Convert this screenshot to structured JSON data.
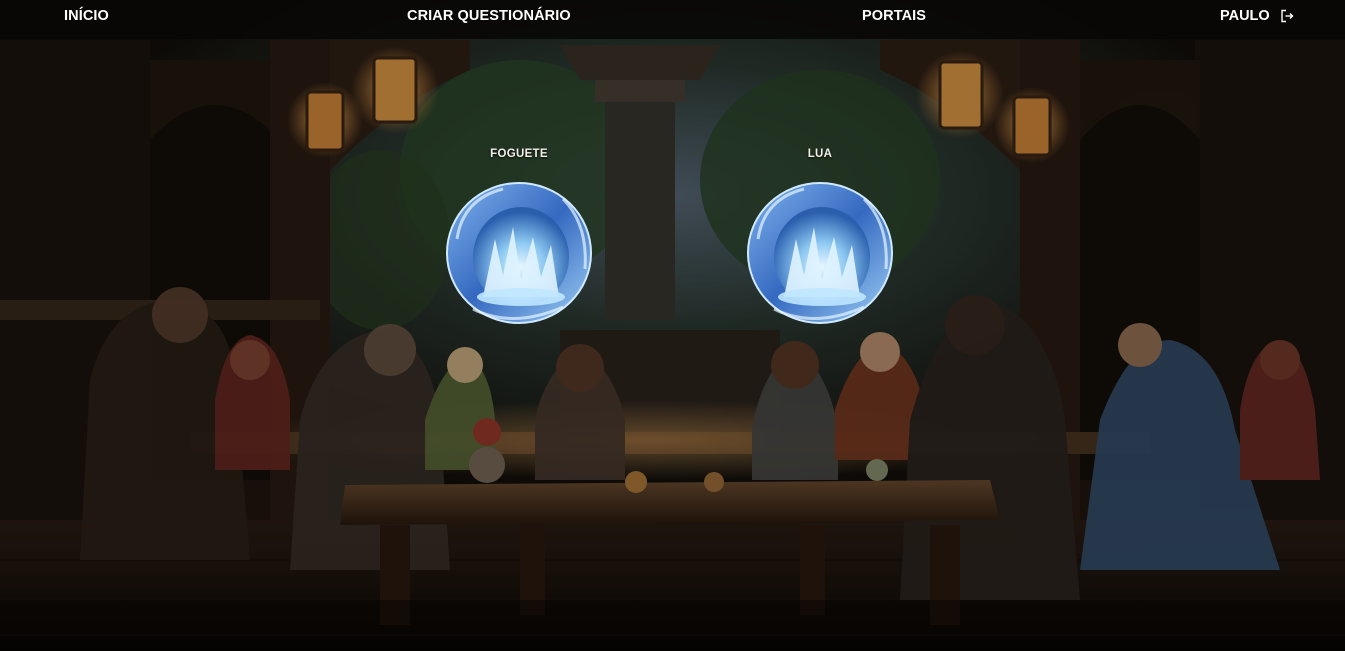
{
  "nav": {
    "home_label": "INÍCIO",
    "create_quiz_label": "CRIAR QUESTIONÁRIO",
    "portals_label": "PORTAIS",
    "user_name": "PAULO",
    "logout_icon": "logout-icon"
  },
  "portals": [
    {
      "label": "FOGUETE",
      "icon": "ice-portal-icon"
    },
    {
      "label": "LUA",
      "icon": "ice-portal-icon"
    }
  ],
  "colors": {
    "navbar_bg": "#080706",
    "nav_text": "#ffffff",
    "portal_ice": "#3f7fd6",
    "portal_glow": "#b9e6ff"
  }
}
